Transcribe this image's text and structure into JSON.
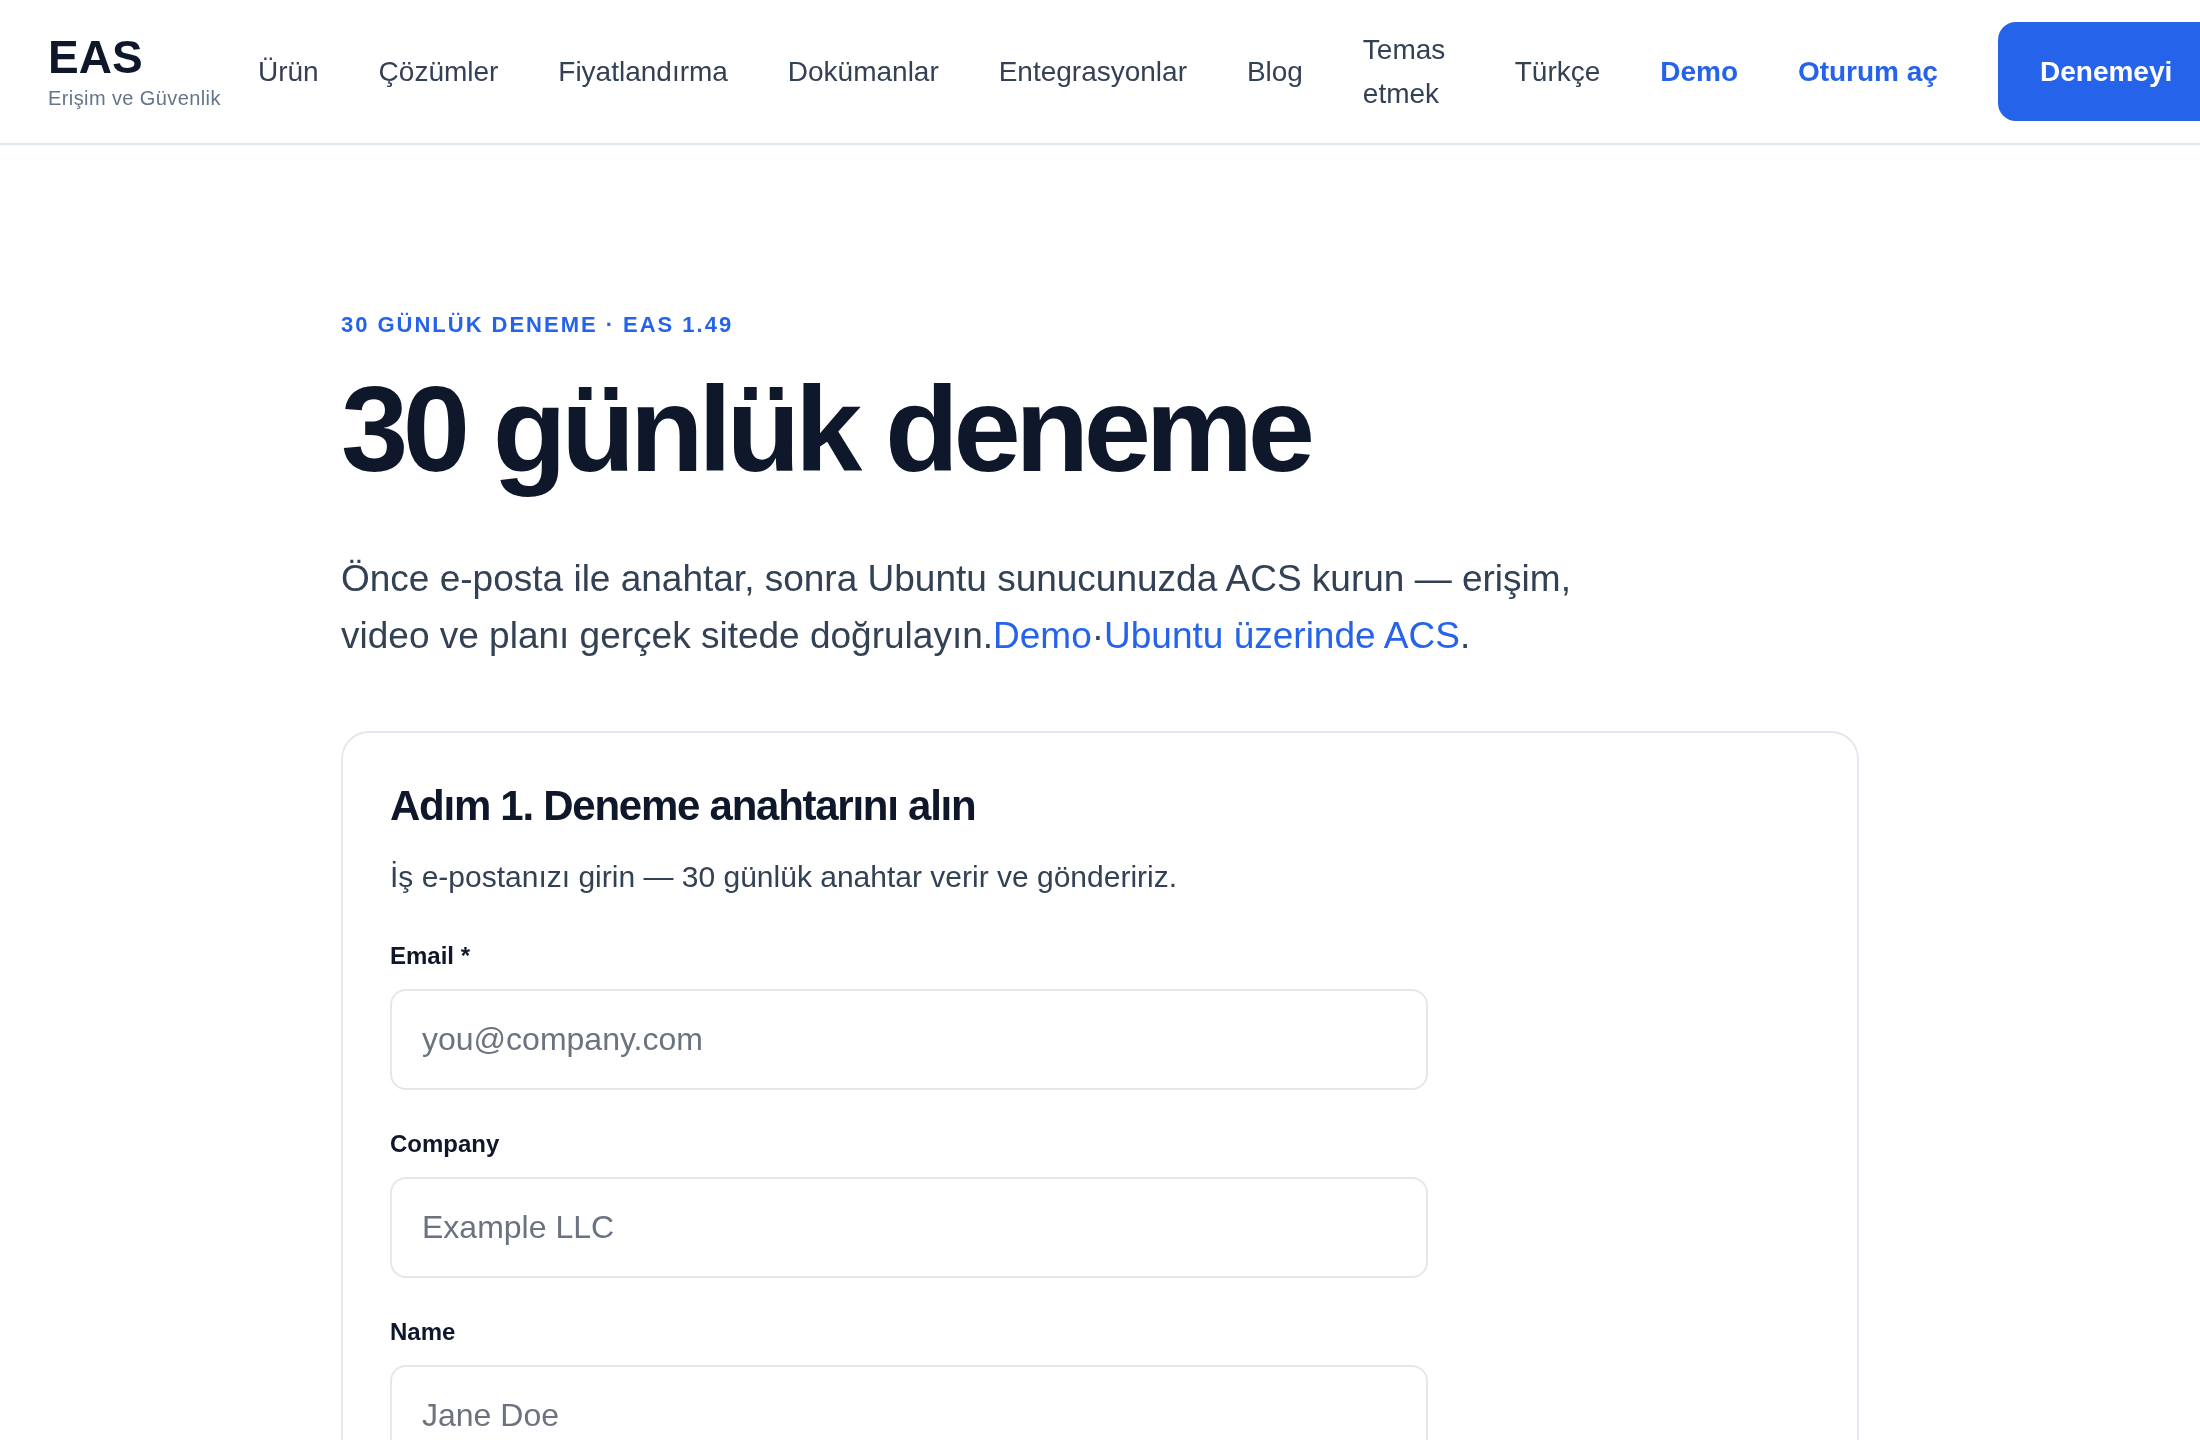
{
  "header": {
    "logo": {
      "name": "EAS",
      "tagline": "Erişim ve Güvenlik"
    },
    "nav": [
      {
        "label": "Ürün",
        "kind": "link"
      },
      {
        "label": "Çözümler",
        "kind": "link"
      },
      {
        "label": "Fiyatlandırma",
        "kind": "link"
      },
      {
        "label": "Dokümanlar",
        "kind": "link"
      },
      {
        "label": "Entegrasyonlar",
        "kind": "link"
      },
      {
        "label": "Blog",
        "kind": "link"
      },
      {
        "label": "Temas etmek",
        "kind": "link"
      },
      {
        "label": "Türkçe",
        "kind": "link"
      },
      {
        "label": "Demo",
        "kind": "accent"
      },
      {
        "label": "Oturum aç",
        "kind": "accent"
      }
    ],
    "cta": {
      "label": "Denemeyi"
    }
  },
  "hero": {
    "eyebrow": "30 GÜNLÜK DENEME · EAS 1.49",
    "title": "30 günlük deneme",
    "intro": {
      "text": "Önce e-posta ile anahtar, sonra Ubuntu sunucunuzda ACS kurun — erişim, video ve planı gerçek sitede doğrulayın.",
      "links": [
        "Demo",
        "Ubuntu üzerinde ACS"
      ],
      "separator": "·",
      "end": "."
    }
  },
  "card": {
    "title": "Adım 1. Deneme anahtarını alın",
    "description": "İş e-postanızı girin — 30 günlük anahtar verir ve göndeririz.",
    "fields": [
      {
        "label": "Email *",
        "placeholder": "you@company.com"
      },
      {
        "label": "Company",
        "placeholder": "Example LLC"
      },
      {
        "label": "Name",
        "placeholder": "Jane Doe"
      }
    ]
  }
}
